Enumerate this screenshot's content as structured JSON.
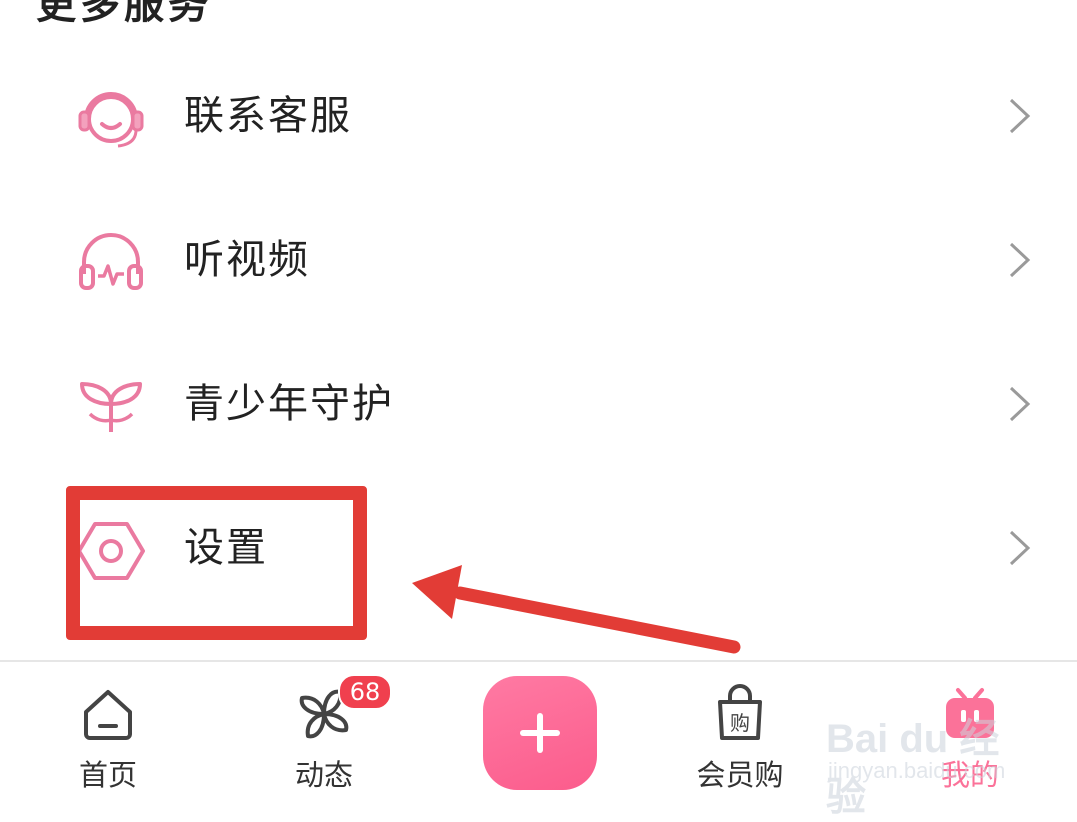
{
  "section": {
    "title": "更多服务"
  },
  "menu": [
    {
      "label": "联系客服",
      "icon": "headset-icon"
    },
    {
      "label": "听视频",
      "icon": "headphones-icon"
    },
    {
      "label": "青少年守护",
      "icon": "sprout-icon"
    },
    {
      "label": "设置",
      "icon": "hex-nut-settings-icon"
    }
  ],
  "tabbar": {
    "home": {
      "label": "首页",
      "icon": "home-icon"
    },
    "dynamic": {
      "label": "动态",
      "icon": "pinwheel-icon",
      "badge": "68"
    },
    "publish": {
      "icon": "plus-icon"
    },
    "mall": {
      "label": "会员购",
      "icon": "shopping-bag-icon"
    },
    "mine": {
      "label": "我的",
      "icon": "tv-icon"
    }
  },
  "watermark": {
    "brand": "Bai du 经验",
    "sub": "jingyan.baidu.com"
  },
  "colors": {
    "accent": "#fb7299",
    "annotation": "#e23c36",
    "text": "#222222",
    "chevron": "#9a9a9a"
  }
}
